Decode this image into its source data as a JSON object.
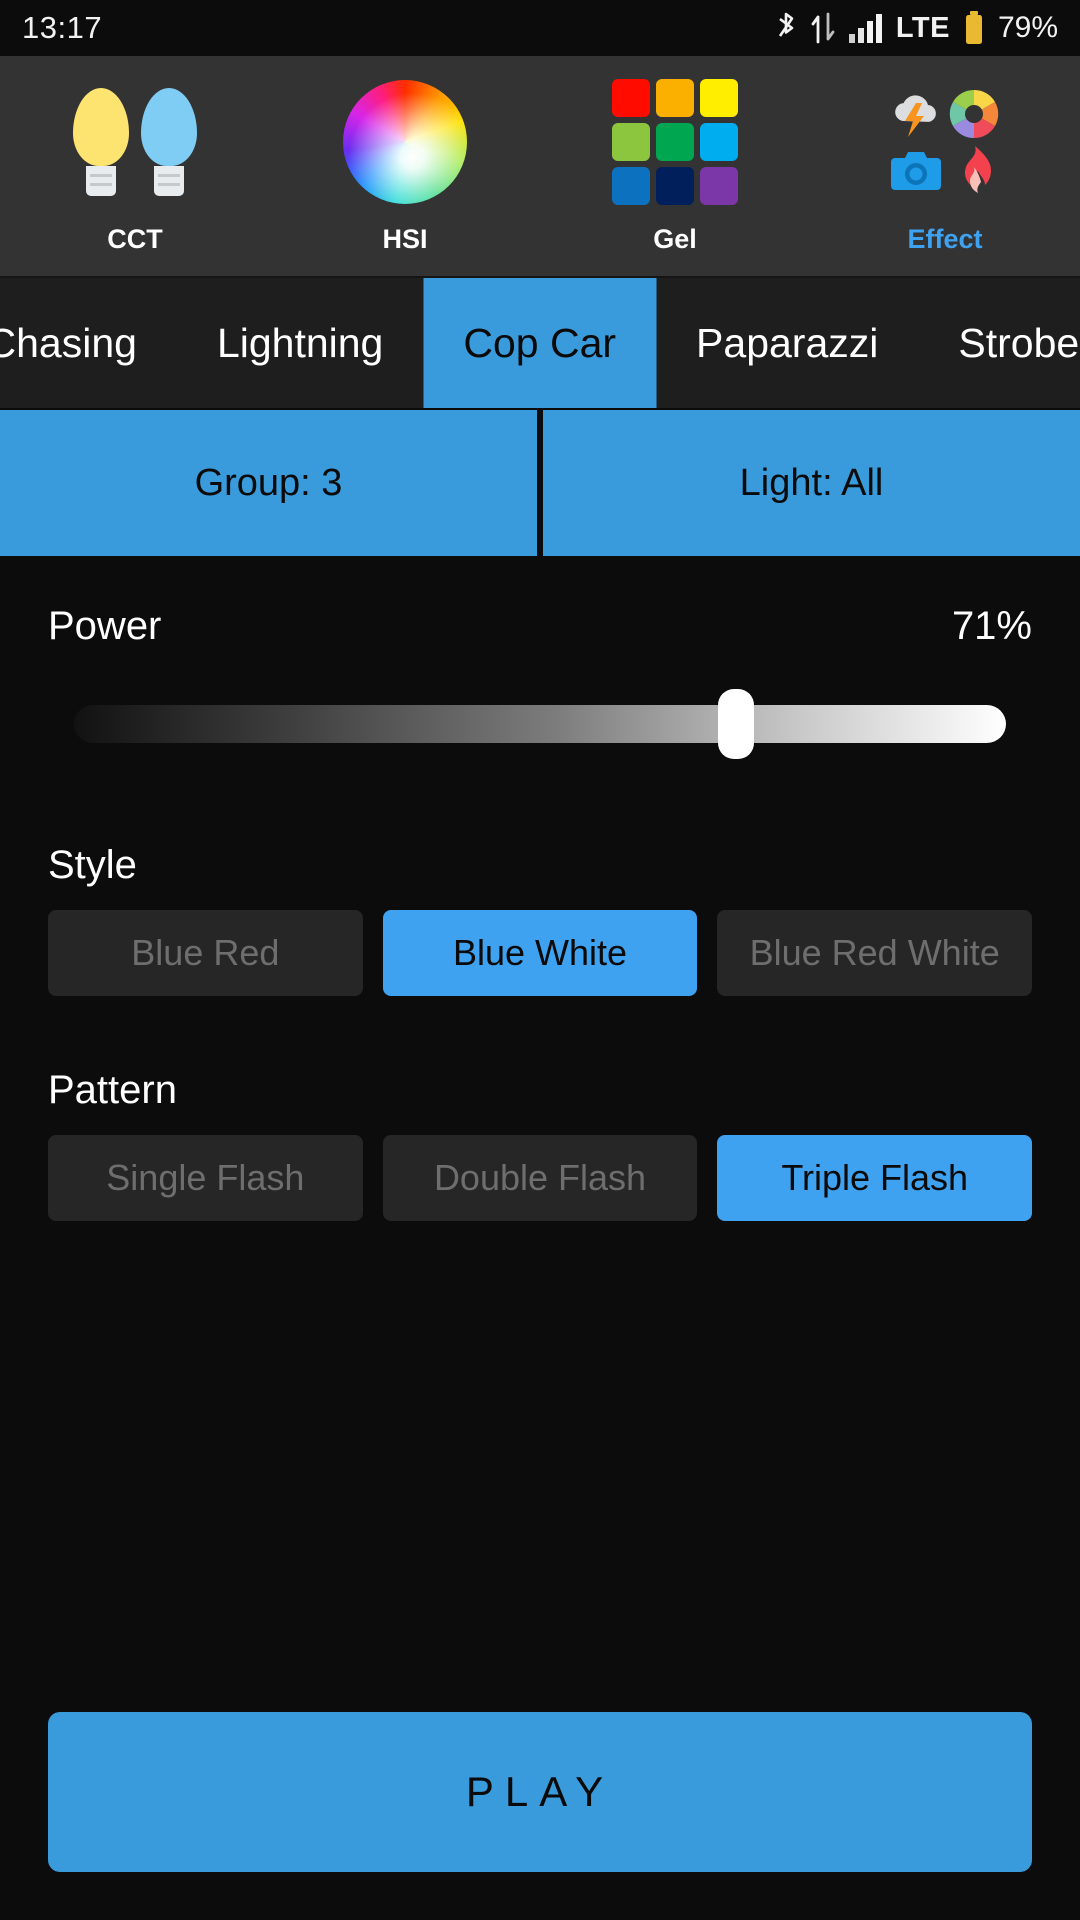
{
  "statusbar": {
    "time": "13:17",
    "network_label": "LTE",
    "battery_percent": "79%",
    "icons": [
      "bluetooth-icon",
      "data-transfer-icon",
      "signal-bars-icon",
      "battery-icon"
    ],
    "battery_color": "#E8B931"
  },
  "modes": {
    "items": [
      {
        "label": "CCT",
        "icon": "light-bulbs-icon",
        "active": false
      },
      {
        "label": "HSI",
        "icon": "color-wheel-icon",
        "active": false
      },
      {
        "label": "Gel",
        "icon": "color-swatches-icon",
        "active": false
      },
      {
        "label": "Effect",
        "icon": "effects-icon",
        "active": true
      }
    ],
    "active_color": "#3FA2F0",
    "bulb_warm_color": "#FDE36F",
    "bulb_cool_color": "#7FCDF5",
    "gel_colors": [
      "#FF0B00",
      "#FBB000",
      "#FFEE00",
      "#8CC63F",
      "#00A650",
      "#00AEEF",
      "#0C72C0",
      "#001F5B",
      "#7B36A8"
    ]
  },
  "effect_tabs": {
    "items": [
      {
        "label": "Chasing",
        "selected": false
      },
      {
        "label": "Lightning",
        "selected": false
      },
      {
        "label": "Cop Car",
        "selected": true
      },
      {
        "label": "Paparazzi",
        "selected": false
      },
      {
        "label": "Strobe",
        "selected": false
      }
    ],
    "selected": "Cop Car",
    "selected_color": "#3A9BDC"
  },
  "target": {
    "group_label": "Group: 3",
    "light_label": "Light: All",
    "bar_color": "#3A9BDC"
  },
  "power": {
    "label": "Power",
    "value_text": "71%",
    "value": 71
  },
  "style": {
    "title": "Style",
    "options": [
      {
        "label": "Blue Red",
        "active": false
      },
      {
        "label": "Blue White",
        "active": true
      },
      {
        "label": "Blue Red White",
        "active": false
      }
    ],
    "selected": "Blue White"
  },
  "pattern": {
    "title": "Pattern",
    "options": [
      {
        "label": "Single Flash",
        "active": false
      },
      {
        "label": "Double Flash",
        "active": false
      },
      {
        "label": "Triple Flash",
        "active": true
      }
    ],
    "selected": "Triple Flash"
  },
  "play": {
    "label": "PLAY",
    "color": "#3A9BDC"
  }
}
